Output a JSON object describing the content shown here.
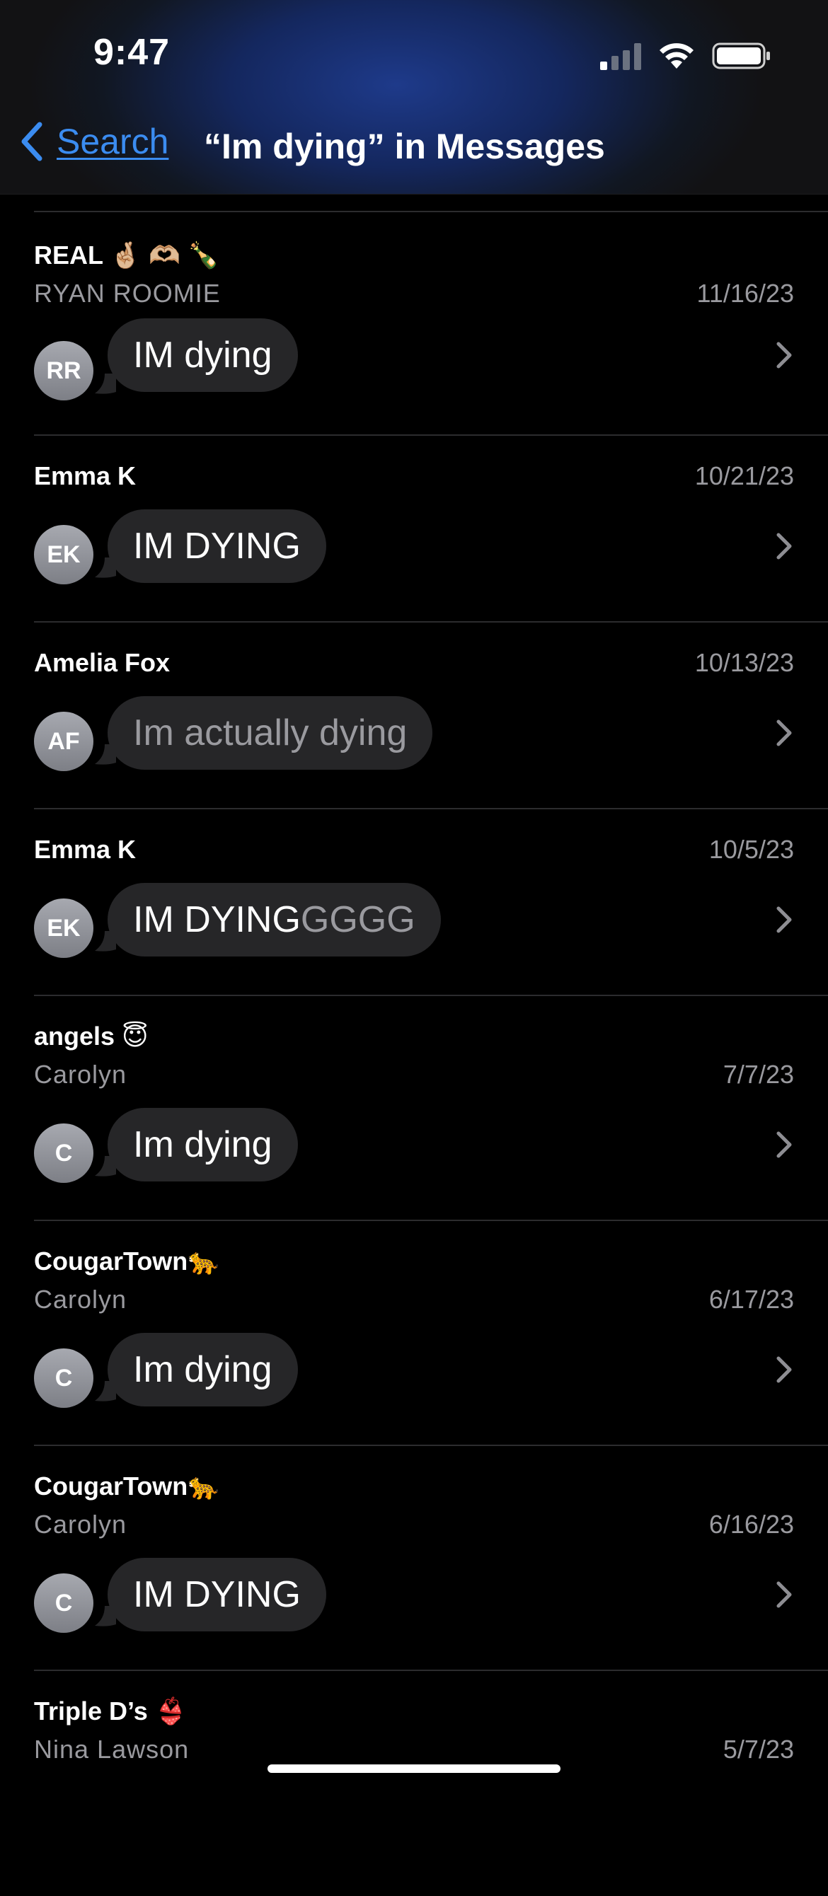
{
  "status_bar": {
    "time": "9:47"
  },
  "nav": {
    "back_label": "Search",
    "title": "“Im dying” in Messages"
  },
  "results": [
    {
      "title": "REAL 🤞🏼 🫶🏼 🍾",
      "subtitle": "RYAN ROOMIE",
      "date": "11/16/23",
      "initials": "RR",
      "message": "IM dying",
      "message_dim": ""
    },
    {
      "title": "Emma K",
      "subtitle": "",
      "date": "10/21/23",
      "initials": "EK",
      "message": "IM DYING",
      "message_dim": ""
    },
    {
      "title": "Amelia Fox",
      "subtitle": "",
      "date": "10/13/23",
      "initials": "AF",
      "message": "",
      "message_dim": "Im actually dying"
    },
    {
      "title": "Emma K",
      "subtitle": "",
      "date": "10/5/23",
      "initials": "EK",
      "message": "IM DYING",
      "message_dim": "GGGG"
    },
    {
      "title": "angels 😇",
      "subtitle": "Carolyn",
      "date": "7/7/23",
      "initials": "C",
      "message": "Im dying",
      "message_dim": ""
    },
    {
      "title": "CougarTown🐆",
      "subtitle": "Carolyn",
      "date": "6/17/23",
      "initials": "C",
      "message": "Im dying",
      "message_dim": ""
    },
    {
      "title": "CougarTown🐆",
      "subtitle": "Carolyn",
      "date": "6/16/23",
      "initials": "C",
      "message": "IM DYING",
      "message_dim": ""
    },
    {
      "title": "Triple D’s 👙",
      "subtitle": "Nina Lawson",
      "date": "5/7/23",
      "initials": "",
      "message": "",
      "message_dim": ""
    }
  ],
  "colors": {
    "accent": "#3b8cf0",
    "bubble": "#262628",
    "secondary_text": "#9a9a9f"
  }
}
